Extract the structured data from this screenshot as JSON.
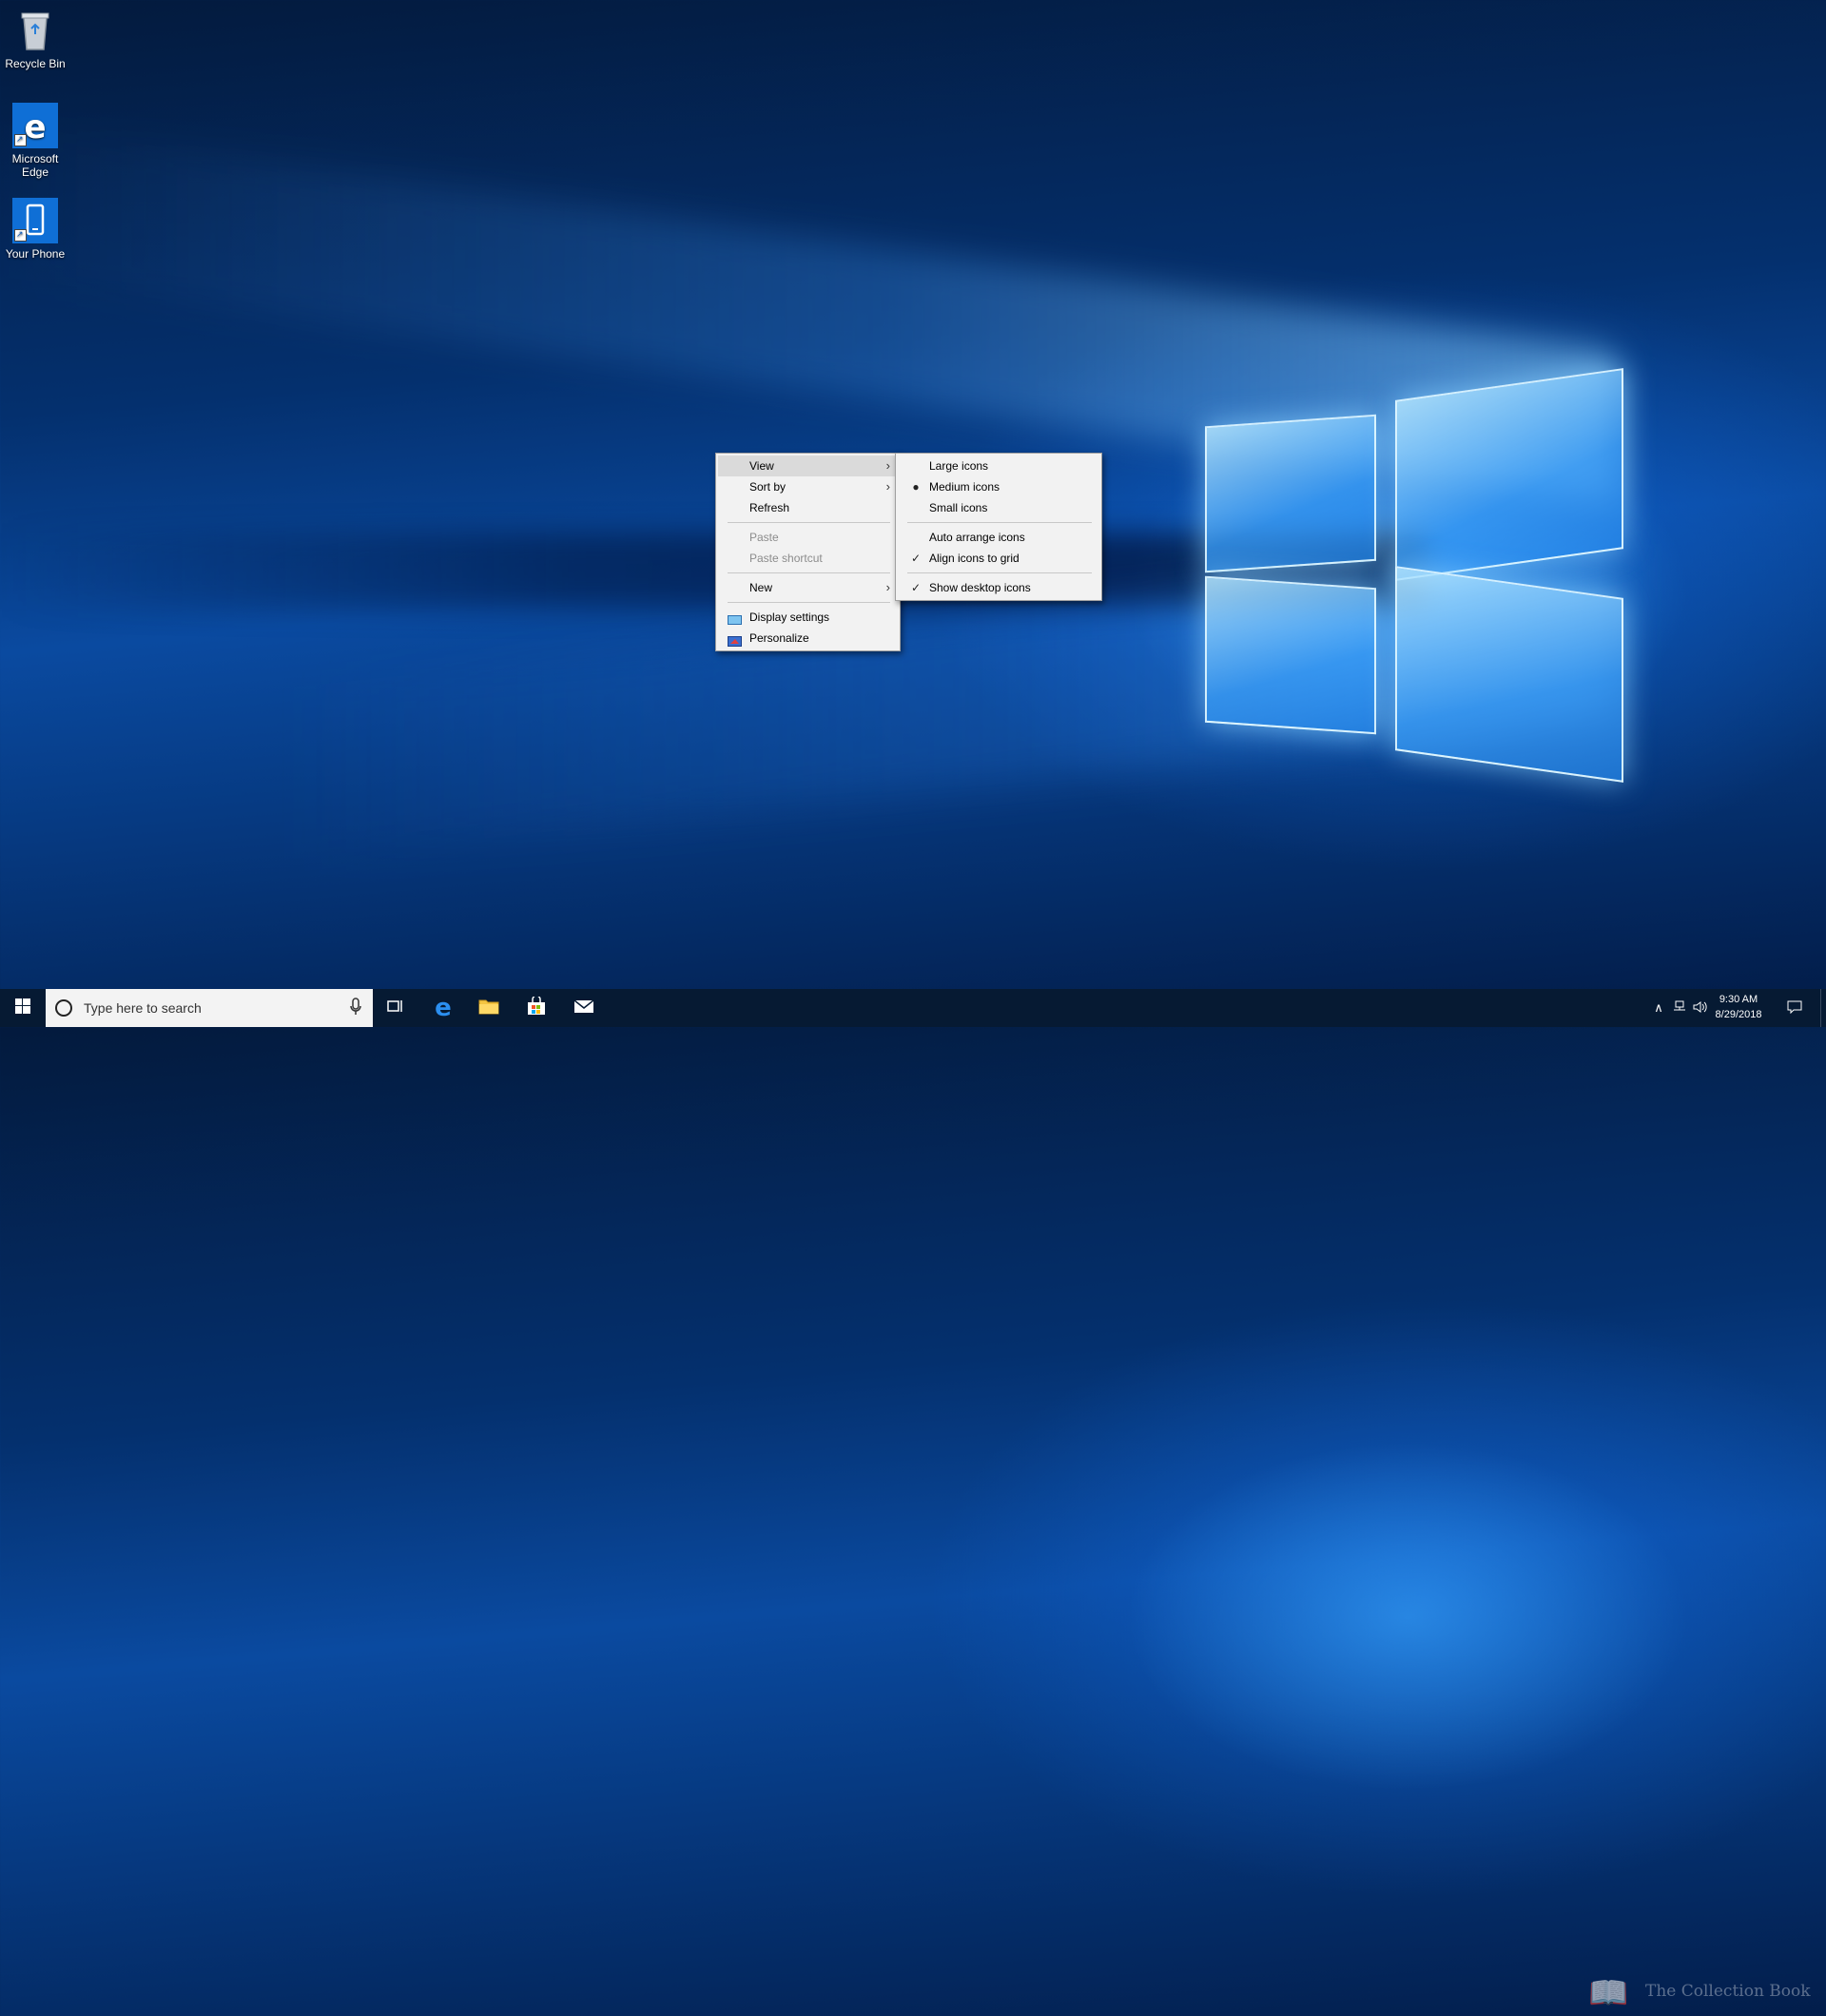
{
  "desktop": {
    "icons": [
      {
        "label": "Recycle Bin",
        "icon": "recycle-bin-icon"
      },
      {
        "label": "Microsoft Edge",
        "icon": "edge-icon"
      },
      {
        "label": "Your Phone",
        "icon": "phone-icon"
      }
    ]
  },
  "context_menu": {
    "items": {
      "view": "View",
      "sort_by": "Sort by",
      "refresh": "Refresh",
      "paste": "Paste",
      "paste_shortcut": "Paste shortcut",
      "new": "New",
      "display_settings": "Display settings",
      "personalize": "Personalize"
    },
    "highlighted": "View",
    "disabled": [
      "Paste",
      "Paste shortcut"
    ]
  },
  "view_submenu": {
    "items": {
      "large_icons": "Large icons",
      "medium_icons": "Medium icons",
      "small_icons": "Small icons",
      "auto_arrange": "Auto arrange icons",
      "align_grid": "Align icons to grid",
      "show_desktop_icons": "Show desktop icons"
    },
    "selected": "Medium icons",
    "checked": [
      "Align icons to grid",
      "Show desktop icons"
    ]
  },
  "taskbar": {
    "search_placeholder": "Type here to search",
    "pinned": [
      "task-view-icon",
      "edge-icon",
      "file-explorer-icon",
      "store-icon",
      "mail-icon"
    ],
    "clock_time": "9:30 AM",
    "clock_date": "8/29/2018",
    "watermark": "The Collection Book"
  },
  "colors": {
    "taskbar_bg": "#061a33",
    "menu_bg": "#f2f2f2",
    "menu_highlight": "#dadada",
    "edge_blue": "#0f6fd6"
  }
}
